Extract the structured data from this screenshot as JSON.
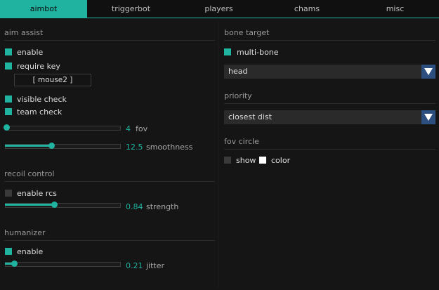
{
  "tabs": [
    "aimbot",
    "triggerbot",
    "players",
    "chams",
    "misc"
  ],
  "aim_assist": {
    "title": "aim assist",
    "enable": {
      "label": "enable",
      "checked": true
    },
    "require_key": {
      "label": "require key",
      "checked": true,
      "key": "[ mouse2 ]"
    },
    "visible_check": {
      "label": "visible check",
      "checked": true
    },
    "team_check": {
      "label": "team check",
      "checked": true
    },
    "fov": {
      "name": "fov",
      "value": "4",
      "fraction": 0.0
    },
    "smoothness": {
      "name": "smoothness",
      "value": "12.5",
      "fraction": 0.39
    }
  },
  "recoil_control": {
    "title": "recoil control",
    "enable_rcs": {
      "label": "enable rcs",
      "checked": false
    },
    "strength": {
      "name": "strength",
      "value": "0.84",
      "fraction": 0.42
    }
  },
  "humanizer": {
    "title": "humanizer",
    "enable": {
      "label": "enable",
      "checked": true
    },
    "jitter": {
      "name": "jitter",
      "value": "0.21",
      "fraction": 0.07
    }
  },
  "bone_target": {
    "title": "bone target",
    "multi_bone": {
      "label": "multi-bone",
      "checked": true
    },
    "selected": "head"
  },
  "priority": {
    "title": "priority",
    "selected": "closest dist"
  },
  "fov_circle": {
    "title": "fov circle",
    "show": {
      "label": "show",
      "checked": false
    },
    "color": {
      "label": "color",
      "swatch": "#ffffff"
    }
  },
  "colors": {
    "accent": "#1fb3a0",
    "dropdown_arrow": "#2d4f80",
    "background": "#151515"
  }
}
